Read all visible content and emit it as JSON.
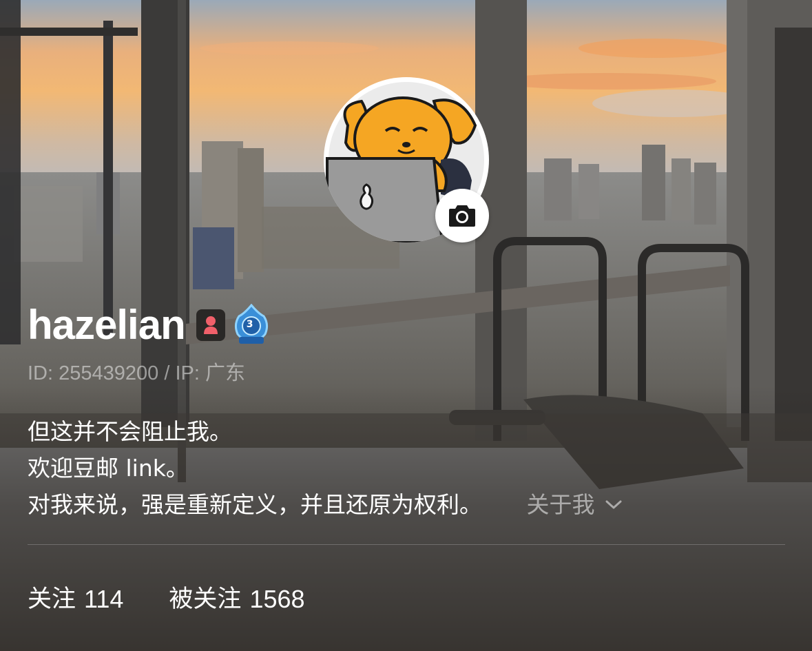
{
  "profile": {
    "username": "hazelian",
    "level": "3",
    "id_label": "ID: 255439200 / IP: 广东",
    "bio_lines": [
      "但这并不会阻止我。",
      "欢迎豆邮 link。",
      "对我来说，强是重新定义，并且还原为权利。"
    ],
    "about_label": "关于我",
    "following_label": "关注",
    "following_count": "114",
    "followers_label": "被关注",
    "followers_count": "1568"
  },
  "colors": {
    "gender_badge": "#f0606a",
    "level_badge": "#3a8fd8",
    "avatar_dog": "#f5a623"
  },
  "icons": {
    "avatar_camera": "camera-icon",
    "gender": "female-icon",
    "level": "level-badge-icon",
    "about_chevron": "chevron-down-icon"
  }
}
